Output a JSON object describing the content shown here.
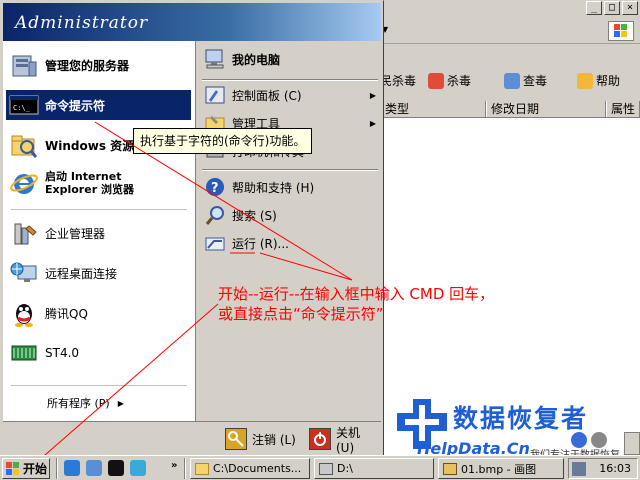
{
  "start_menu": {
    "user": "Administrator",
    "left_items": [
      {
        "label": "管理您的服务器",
        "icon": "server-icon"
      },
      {
        "label": "命令提示符",
        "icon": "cmd-icon",
        "selected": true
      },
      {
        "label": "Windows 资源管理器",
        "icon": "explorer-icon"
      },
      {
        "label_line1": "启动 Internet",
        "label_line2": "Explorer 浏览器",
        "icon": "ie-icon"
      },
      {
        "label": "企业管理器",
        "icon": "enterprise-manager-icon"
      },
      {
        "label": "远程桌面连接",
        "icon": "remote-desktop-icon"
      },
      {
        "label": "腾讯QQ",
        "icon": "qq-icon"
      },
      {
        "label": "ST4.0",
        "icon": "st-icon"
      }
    ],
    "all_programs": "所有程序 (P)",
    "right_items": [
      {
        "label": "我的电脑",
        "icon": "my-computer-icon"
      },
      {
        "label": "控制面板 (C)",
        "icon": "control-panel-icon"
      },
      {
        "label": "管理工具",
        "icon": "admin-tools-icon"
      },
      {
        "label": "打印机和传真",
        "icon": "printer-icon"
      },
      {
        "label": "帮助和支持 (H)",
        "icon": "help-icon"
      },
      {
        "label": "搜索 (S)",
        "icon": "search-icon"
      },
      {
        "label": "运行 (R)...",
        "icon": "run-icon"
      }
    ],
    "logoff_label": "注销 (L)",
    "shutdown_label": "关机 (U)",
    "tooltip": "执行基于字符的(命令行)功能。"
  },
  "annotation": {
    "line1": "开始--运行--在输入框中输入  CMD  回车，",
    "line2": "或直接点击“命令提示符”",
    "color": "#ff0000"
  },
  "watermark": {
    "title": "数据恢复者",
    "url": "HelpData.Cn",
    "slogan": "我们专注于数据恢复",
    "color": "#1f5fd6"
  },
  "background_window": {
    "title_buttons": [
      "_",
      "□",
      "×"
    ],
    "toolbar": [
      "民杀毒",
      "杀毒",
      "查毒",
      "帮助"
    ],
    "columns": [
      "类型",
      "修改日期",
      "属性"
    ]
  },
  "taskbar": {
    "start_label": "开始",
    "tasks": [
      "C:\\Documents...",
      "D:\\",
      "01.bmp - 画图"
    ],
    "clock": "16:03"
  }
}
